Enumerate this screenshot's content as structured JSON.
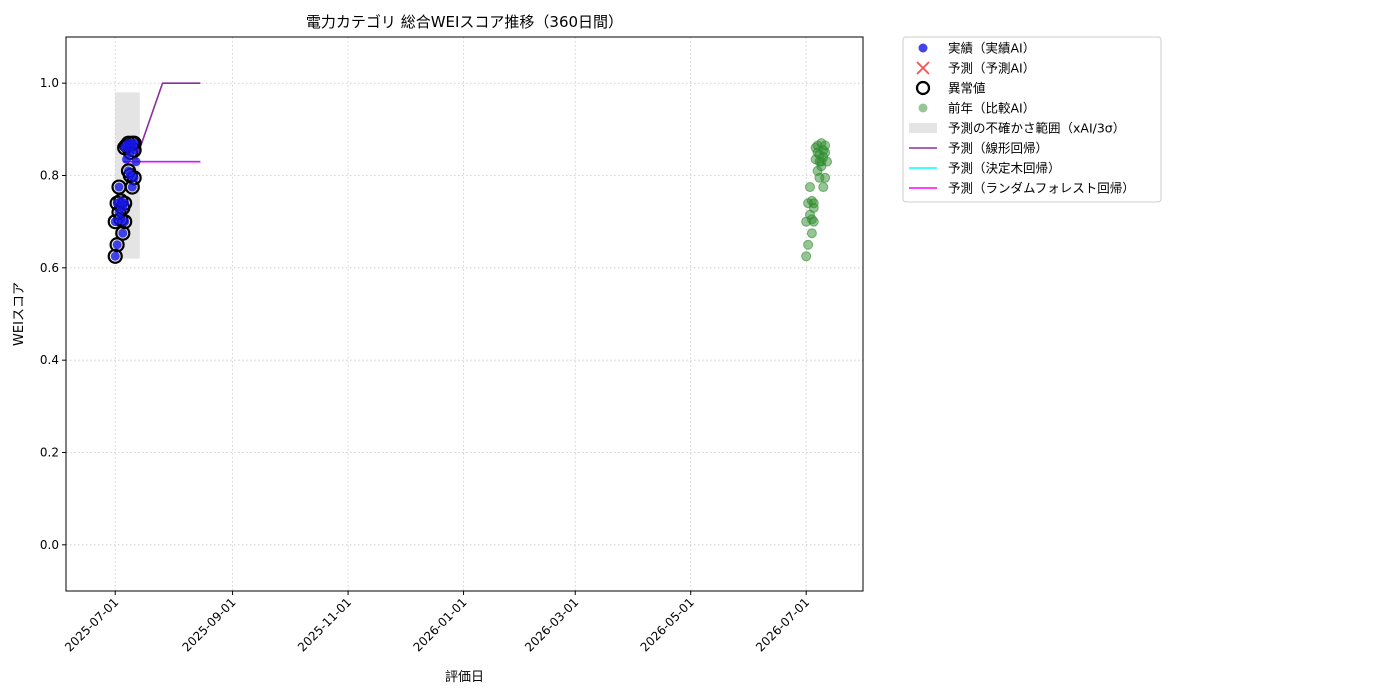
{
  "chart_data": {
    "type": "scatter",
    "title": "電力カテゴリ 総合WEIスコア推移（360日間）",
    "xlabel": "評価日",
    "ylabel": "WEIスコア",
    "xlim": [
      "2025-06-05",
      "2026-07-31"
    ],
    "ylim": [
      -0.1,
      1.1
    ],
    "grid": true,
    "legend_position": "outside-top-right",
    "x_ticks": [
      "2025-07-01",
      "2025-09-01",
      "2025-11-01",
      "2026-01-01",
      "2026-03-01",
      "2026-05-01",
      "2026-07-01"
    ],
    "y_ticks": [
      0.0,
      0.2,
      0.4,
      0.6,
      0.8,
      1.0
    ],
    "y_tick_labels": [
      "0.0",
      "0.2",
      "0.4",
      "0.6",
      "0.8",
      "1.0"
    ],
    "colors": {
      "actual": "#1515e6",
      "forecast": "#ff3030",
      "anomaly": "#000000",
      "previous_year": "#2e8b2e",
      "uncertainty": "#d9d9d9",
      "linear": "#8b2e9e",
      "tree": "#00ffff",
      "forest": "#ff00ff"
    },
    "legend": [
      {
        "key": "actual",
        "label": "実績（実績AI）"
      },
      {
        "key": "forecast",
        "label": "予測（予測AI）"
      },
      {
        "key": "anomaly",
        "label": "異常値"
      },
      {
        "key": "previous_year",
        "label": "前年（比較AI）"
      },
      {
        "key": "uncertainty",
        "label": "予測の不確かさ範囲（xAI/3σ）"
      },
      {
        "key": "linear",
        "label": "予測（線形回帰）"
      },
      {
        "key": "tree",
        "label": "予測（決定木回帰）"
      },
      {
        "key": "forest",
        "label": "予測（ランダムフォレスト回帰）"
      }
    ],
    "actual": [
      {
        "x": "2025-07-01",
        "y": 0.625
      },
      {
        "x": "2025-07-01",
        "y": 0.7
      },
      {
        "x": "2025-07-02",
        "y": 0.65
      },
      {
        "x": "2025-07-02",
        "y": 0.74
      },
      {
        "x": "2025-07-03",
        "y": 0.775
      },
      {
        "x": "2025-07-03",
        "y": 0.72
      },
      {
        "x": "2025-07-04",
        "y": 0.705
      },
      {
        "x": "2025-07-04",
        "y": 0.745
      },
      {
        "x": "2025-07-05",
        "y": 0.73
      },
      {
        "x": "2025-07-05",
        "y": 0.675
      },
      {
        "x": "2025-07-06",
        "y": 0.7
      },
      {
        "x": "2025-07-06",
        "y": 0.74
      },
      {
        "x": "2025-07-06",
        "y": 0.86
      },
      {
        "x": "2025-07-07",
        "y": 0.835
      },
      {
        "x": "2025-07-07",
        "y": 0.865
      },
      {
        "x": "2025-07-08",
        "y": 0.81
      },
      {
        "x": "2025-07-08",
        "y": 0.87
      },
      {
        "x": "2025-07-09",
        "y": 0.85
      },
      {
        "x": "2025-07-09",
        "y": 0.8
      },
      {
        "x": "2025-07-10",
        "y": 0.87
      },
      {
        "x": "2025-07-10",
        "y": 0.775
      },
      {
        "x": "2025-07-11",
        "y": 0.855
      },
      {
        "x": "2025-07-11",
        "y": 0.795
      },
      {
        "x": "2025-07-11",
        "y": 0.87
      },
      {
        "x": "2025-07-12",
        "y": 0.83
      }
    ],
    "anomalies": [
      {
        "x": "2025-07-01",
        "y": 0.625
      },
      {
        "x": "2025-07-01",
        "y": 0.7
      },
      {
        "x": "2025-07-02",
        "y": 0.65
      },
      {
        "x": "2025-07-02",
        "y": 0.74
      },
      {
        "x": "2025-07-03",
        "y": 0.775
      },
      {
        "x": "2025-07-03",
        "y": 0.72
      },
      {
        "x": "2025-07-04",
        "y": 0.705
      },
      {
        "x": "2025-07-04",
        "y": 0.745
      },
      {
        "x": "2025-07-05",
        "y": 0.73
      },
      {
        "x": "2025-07-05",
        "y": 0.675
      },
      {
        "x": "2025-07-06",
        "y": 0.7
      },
      {
        "x": "2025-07-06",
        "y": 0.74
      },
      {
        "x": "2025-07-06",
        "y": 0.86
      },
      {
        "x": "2025-07-07",
        "y": 0.865
      },
      {
        "x": "2025-07-08",
        "y": 0.81
      },
      {
        "x": "2025-07-08",
        "y": 0.87
      },
      {
        "x": "2025-07-09",
        "y": 0.85
      },
      {
        "x": "2025-07-09",
        "y": 0.8
      },
      {
        "x": "2025-07-10",
        "y": 0.87
      },
      {
        "x": "2025-07-10",
        "y": 0.775
      },
      {
        "x": "2025-07-11",
        "y": 0.855
      },
      {
        "x": "2025-07-11",
        "y": 0.795
      },
      {
        "x": "2025-07-11",
        "y": 0.87
      }
    ],
    "forecast_band": {
      "x_start": "2025-07-01",
      "x_end": "2025-07-14",
      "y_low": 0.62,
      "y_high": 0.98
    },
    "linear_forecast": [
      {
        "x": "2025-07-12",
        "y": 0.835
      },
      {
        "x": "2025-07-26",
        "y": 1.0
      },
      {
        "x": "2025-08-15",
        "y": 1.0
      }
    ],
    "tree_forecast": [
      {
        "x": "2025-07-05",
        "y": 0.83
      },
      {
        "x": "2025-08-15",
        "y": 0.83
      }
    ],
    "forest_forecast": [
      {
        "x": "2025-07-05",
        "y": 0.83
      },
      {
        "x": "2025-08-15",
        "y": 0.83
      }
    ],
    "previous_year": [
      {
        "x": "2026-07-01",
        "y": 0.625
      },
      {
        "x": "2026-07-01",
        "y": 0.7
      },
      {
        "x": "2026-07-02",
        "y": 0.65
      },
      {
        "x": "2026-07-02",
        "y": 0.74
      },
      {
        "x": "2026-07-03",
        "y": 0.775
      },
      {
        "x": "2026-07-03",
        "y": 0.715
      },
      {
        "x": "2026-07-04",
        "y": 0.705
      },
      {
        "x": "2026-07-04",
        "y": 0.745
      },
      {
        "x": "2026-07-05",
        "y": 0.73
      },
      {
        "x": "2026-07-04",
        "y": 0.675
      },
      {
        "x": "2026-07-05",
        "y": 0.7
      },
      {
        "x": "2026-07-05",
        "y": 0.74
      },
      {
        "x": "2026-07-06",
        "y": 0.86
      },
      {
        "x": "2026-07-06",
        "y": 0.835
      },
      {
        "x": "2026-07-07",
        "y": 0.865
      },
      {
        "x": "2026-07-07",
        "y": 0.81
      },
      {
        "x": "2026-07-08",
        "y": 0.845
      },
      {
        "x": "2026-07-08",
        "y": 0.795
      },
      {
        "x": "2026-07-09",
        "y": 0.87
      },
      {
        "x": "2026-07-09",
        "y": 0.83
      },
      {
        "x": "2026-07-10",
        "y": 0.775
      },
      {
        "x": "2026-07-10",
        "y": 0.855
      },
      {
        "x": "2026-07-11",
        "y": 0.795
      },
      {
        "x": "2026-07-11",
        "y": 0.865
      },
      {
        "x": "2026-07-12",
        "y": 0.83
      },
      {
        "x": "2026-07-07",
        "y": 0.85
      },
      {
        "x": "2026-07-08",
        "y": 0.83
      },
      {
        "x": "2026-07-09",
        "y": 0.82
      },
      {
        "x": "2026-07-10",
        "y": 0.84
      },
      {
        "x": "2026-07-11",
        "y": 0.85
      }
    ]
  }
}
